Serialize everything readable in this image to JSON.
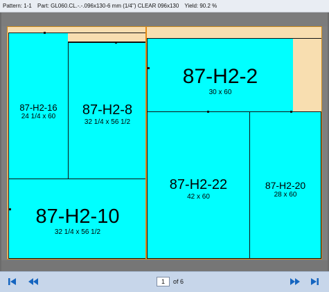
{
  "header": {
    "pattern": "Pattern: 1-1",
    "part": "Part: GL060.CL.-.-.096x130-6 mm (1/4\") CLEAR 096x130",
    "yield": "Yield: 90.2 %"
  },
  "pieces": {
    "h2_16": {
      "id": "87-H2-16",
      "dims": "24 1/4 x 60"
    },
    "h2_8": {
      "id": "87-H2-8",
      "dims": "32 1/4 x 56 1/2"
    },
    "h2_2": {
      "id": "87-H2-2",
      "dims": "30 x 60"
    },
    "h2_22": {
      "id": "87-H2-22",
      "dims": "42 x 60"
    },
    "h2_20": {
      "id": "87-H2-20",
      "dims": "28 x 60"
    },
    "h2_10": {
      "id": "87-H2-10",
      "dims": "32 1/4 x 56 1/2"
    }
  },
  "pagination": {
    "current": "1",
    "of_label": "of 6"
  },
  "colors": {
    "glass": "#00ffff",
    "sheet": "#f8deb0",
    "cut_line": "#e68a12",
    "toolbar": "#c7d6ea",
    "nav": "#1565c0"
  },
  "icons": [
    "first-page-icon",
    "previous-page-icon",
    "next-page-icon",
    "last-page-icon"
  ]
}
